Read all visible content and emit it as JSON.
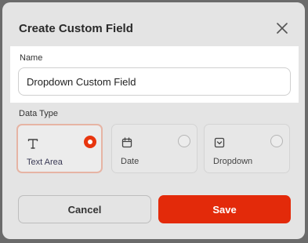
{
  "dialog": {
    "title": "Create Custom Field",
    "close_icon": "close-icon"
  },
  "name_field": {
    "label": "Name",
    "value": "Dropdown Custom Field"
  },
  "data_type": {
    "label": "Data Type",
    "selected": "Text Area",
    "options": [
      {
        "label": "Text Area",
        "icon": "text-icon",
        "selected": true
      },
      {
        "label": "Date",
        "icon": "calendar-icon",
        "selected": false
      },
      {
        "label": "Dropdown",
        "icon": "dropdown-icon",
        "selected": false
      }
    ]
  },
  "actions": {
    "cancel_label": "Cancel",
    "save_label": "Save"
  },
  "colors": {
    "accent": "#e32a0a",
    "selected_border": "#e6b4a4",
    "overlay": "#6b6b6b",
    "dialog_bg": "#e4e4e4"
  }
}
